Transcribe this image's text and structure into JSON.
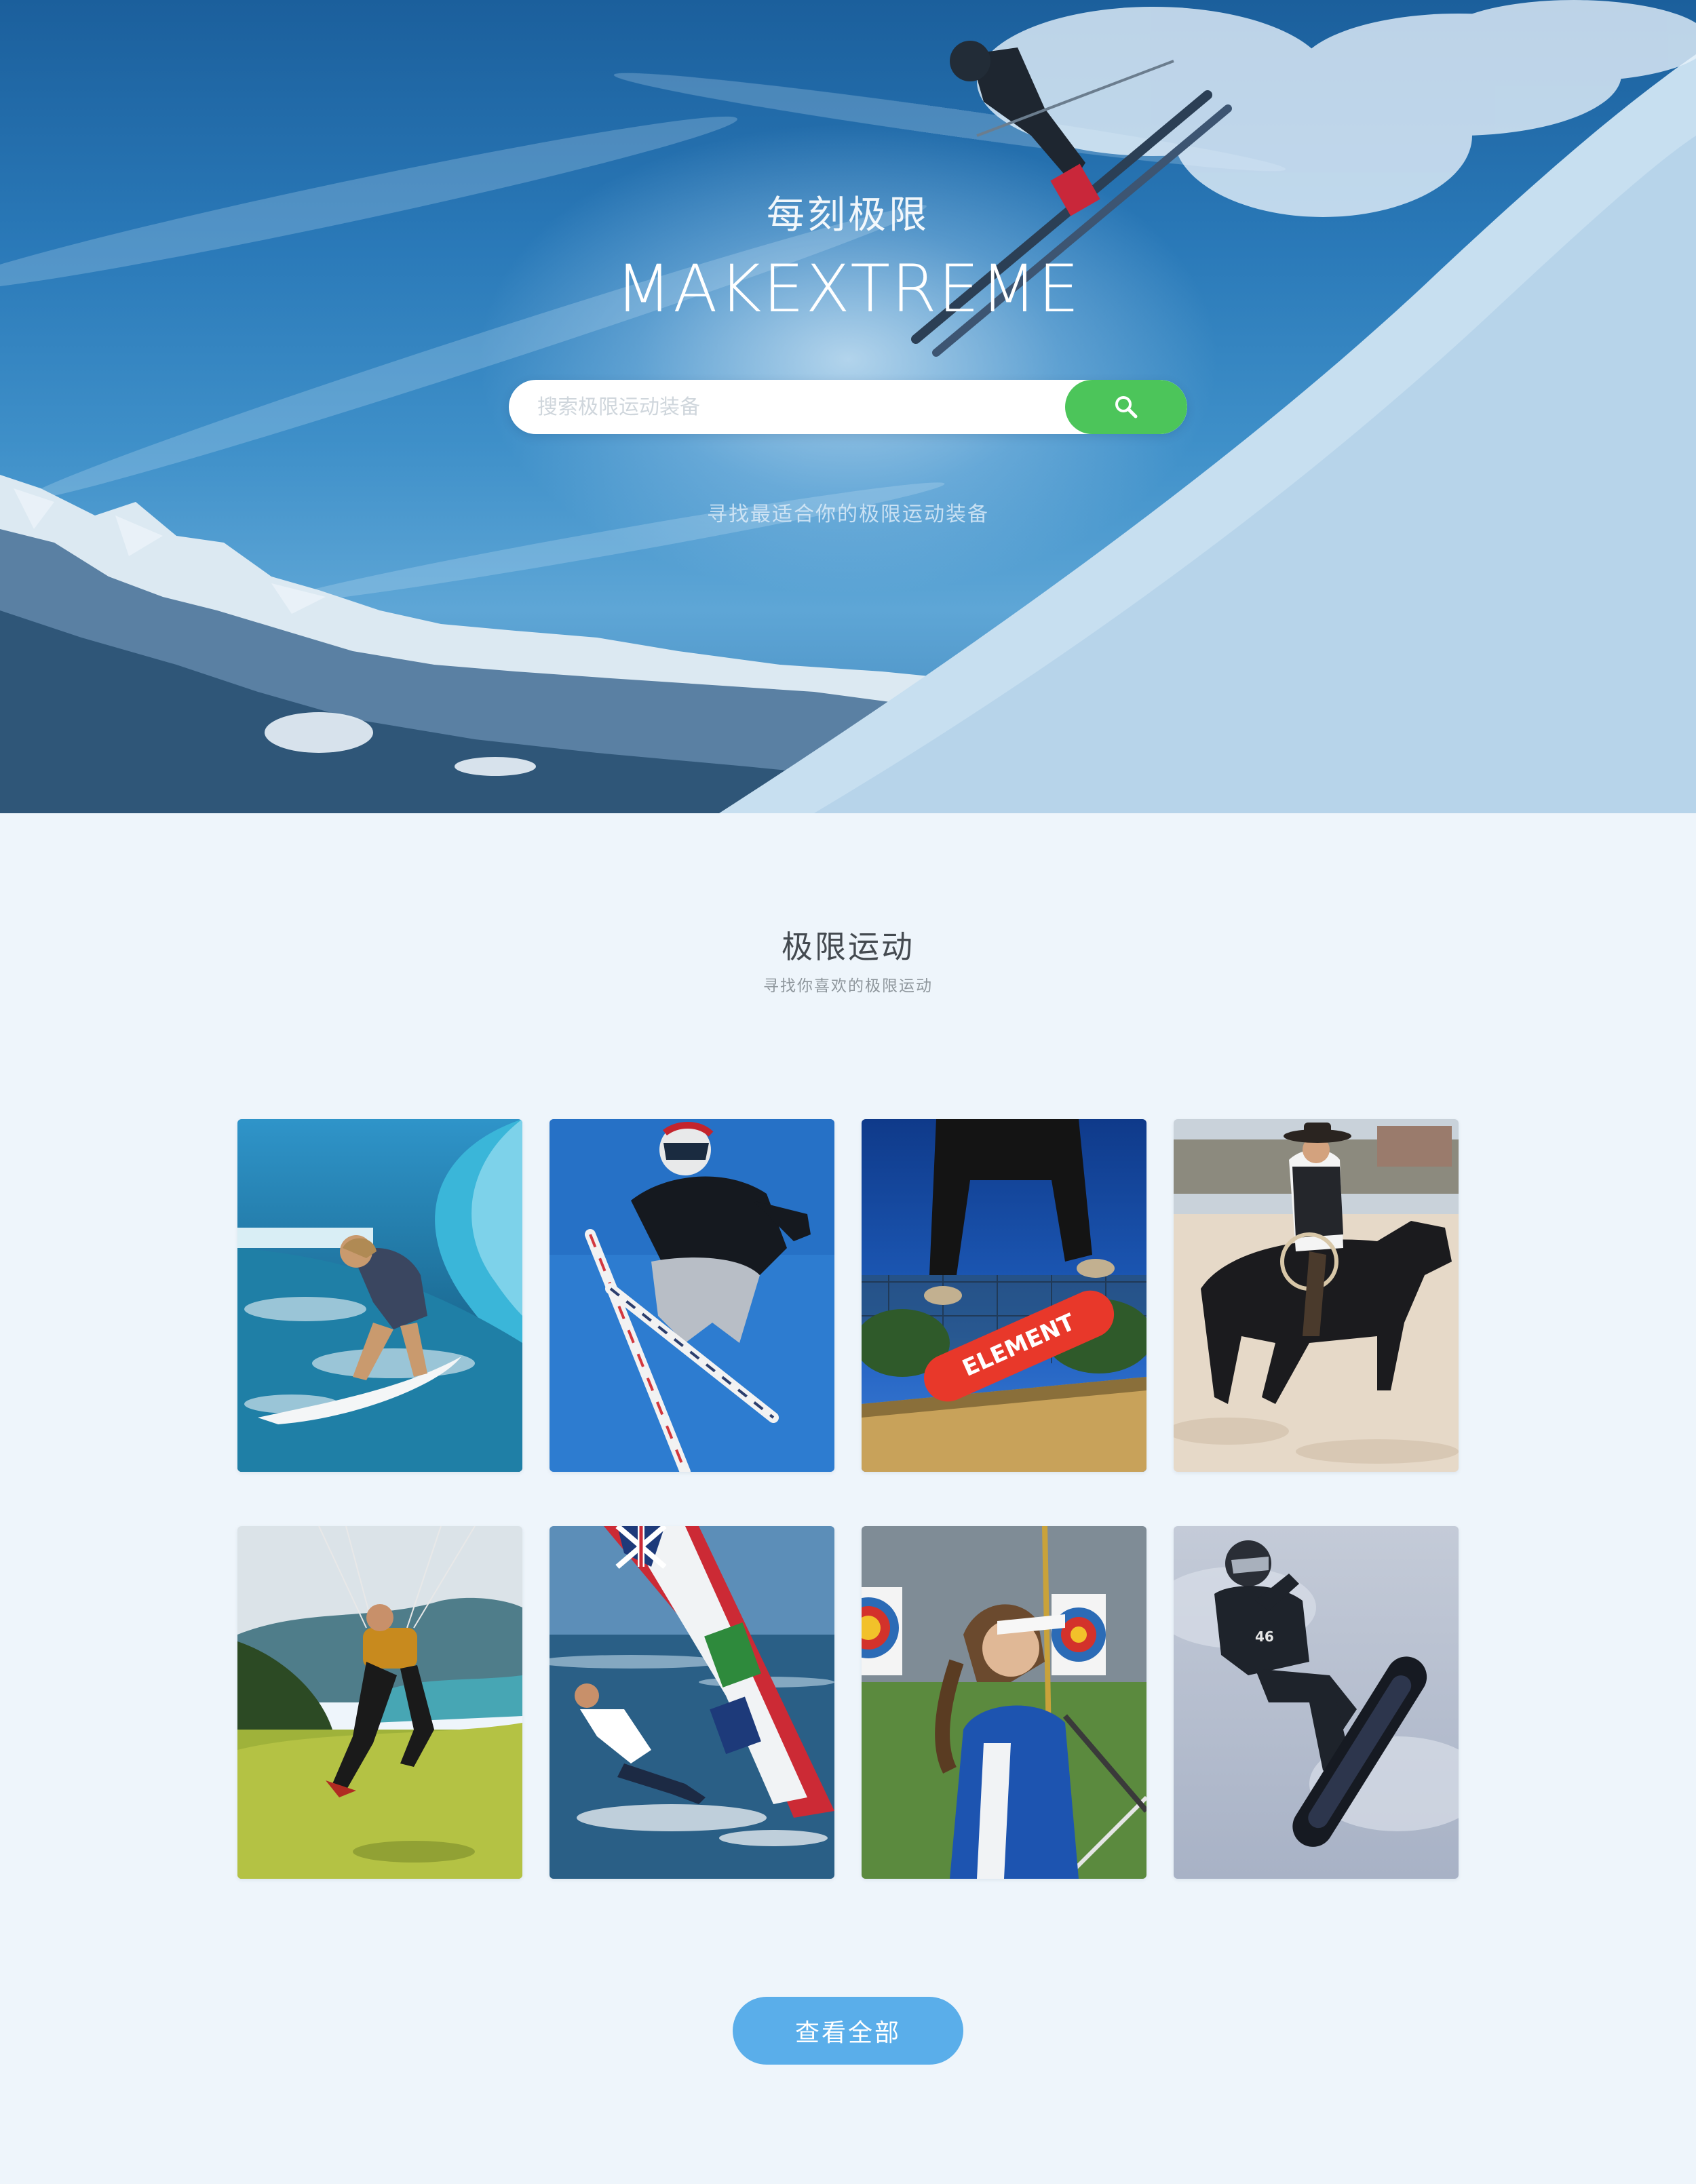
{
  "hero": {
    "subtitle": "每刻极限",
    "title": "MAKEXTREME",
    "search_placeholder": "搜索极限运动装备",
    "search_icon": "search-icon",
    "tagline": "寻找最适合你的极限运动装备"
  },
  "section": {
    "title": "极限运动",
    "subtitle": "寻找你喜欢的极限运动"
  },
  "cards": [
    {
      "sport": "surfing"
    },
    {
      "sport": "freestyle-skiing"
    },
    {
      "sport": "skateboarding"
    },
    {
      "sport": "horse-riding"
    },
    {
      "sport": "paragliding"
    },
    {
      "sport": "windsurfing"
    },
    {
      "sport": "archery"
    },
    {
      "sport": "snowboarding"
    }
  ],
  "view_all_label": "查看全部",
  "colors": {
    "search_button": "#4cc55a",
    "view_all_button": "#5aaeea",
    "page_background": "#eef5fb"
  }
}
